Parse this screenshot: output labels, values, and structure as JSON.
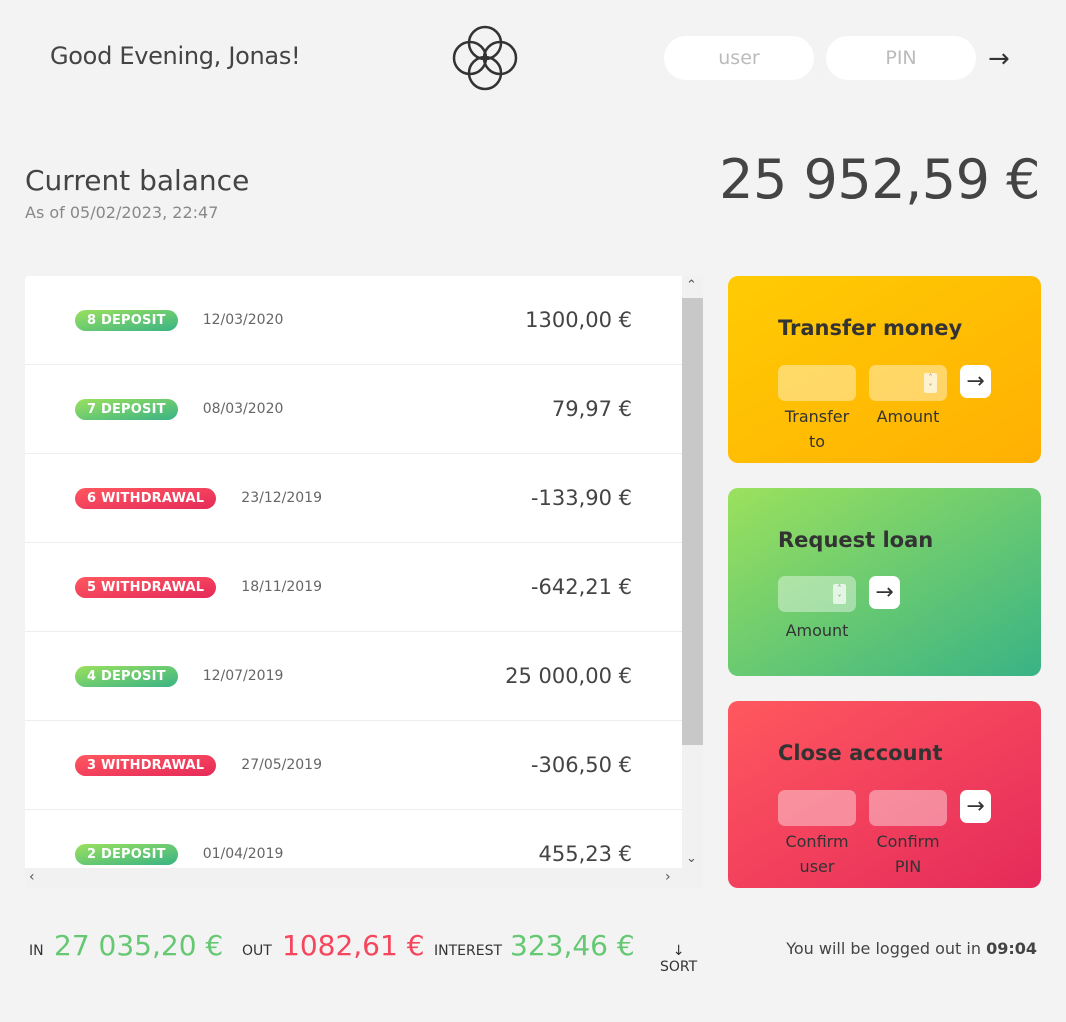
{
  "nav": {
    "welcome": "Good Evening, Jonas!",
    "user_placeholder": "user",
    "pin_placeholder": "PIN",
    "login_arrow": "→"
  },
  "balance": {
    "label": "Current balance",
    "date": "As of 05/02/2023, 22:47",
    "value": "25 952,59 €"
  },
  "movements": [
    {
      "type_label": "8 DEPOSIT",
      "kind": "deposit",
      "date": "12/03/2020",
      "value": "1300,00 €"
    },
    {
      "type_label": "7 DEPOSIT",
      "kind": "deposit",
      "date": "08/03/2020",
      "value": "79,97 €"
    },
    {
      "type_label": "6 WITHDRAWAL",
      "kind": "withdrawal",
      "date": "23/12/2019",
      "value": "-133,90 €"
    },
    {
      "type_label": "5 WITHDRAWAL",
      "kind": "withdrawal",
      "date": "18/11/2019",
      "value": "-642,21 €"
    },
    {
      "type_label": "4 DEPOSIT",
      "kind": "deposit",
      "date": "12/07/2019",
      "value": "25 000,00 €"
    },
    {
      "type_label": "3 WITHDRAWAL",
      "kind": "withdrawal",
      "date": "27/05/2019",
      "value": "-306,50 €"
    },
    {
      "type_label": "2 DEPOSIT",
      "kind": "deposit",
      "date": "01/04/2019",
      "value": "455,23 €"
    }
  ],
  "operations": {
    "transfer": {
      "title": "Transfer money",
      "label_to": "Transfer to",
      "label_amount": "Amount",
      "arrow": "→"
    },
    "loan": {
      "title": "Request loan",
      "label_amount": "Amount",
      "arrow": "→"
    },
    "close": {
      "title": "Close account",
      "label_user": "Confirm user",
      "label_pin": "Confirm PIN",
      "arrow": "→"
    }
  },
  "summary": {
    "in_label": "In",
    "in_value": "27 035,20 €",
    "out_label": "Out",
    "out_value": "1082,61 €",
    "interest_label": "Interest",
    "interest_value": "323,46 €",
    "sort_arrow": "↓",
    "sort_label": "SORT"
  },
  "logout": {
    "text": "You will be logged out in ",
    "timer": "09:04"
  },
  "colors": {
    "deposit_gradient": [
      "#9be15d",
      "#39b385"
    ],
    "withdrawal_gradient": [
      "#ff585f",
      "#e52a5a"
    ],
    "transfer_gradient": [
      "#ffcb03",
      "#ffb003"
    ],
    "in_color": "#66c873",
    "out_color": "#f5465d"
  }
}
